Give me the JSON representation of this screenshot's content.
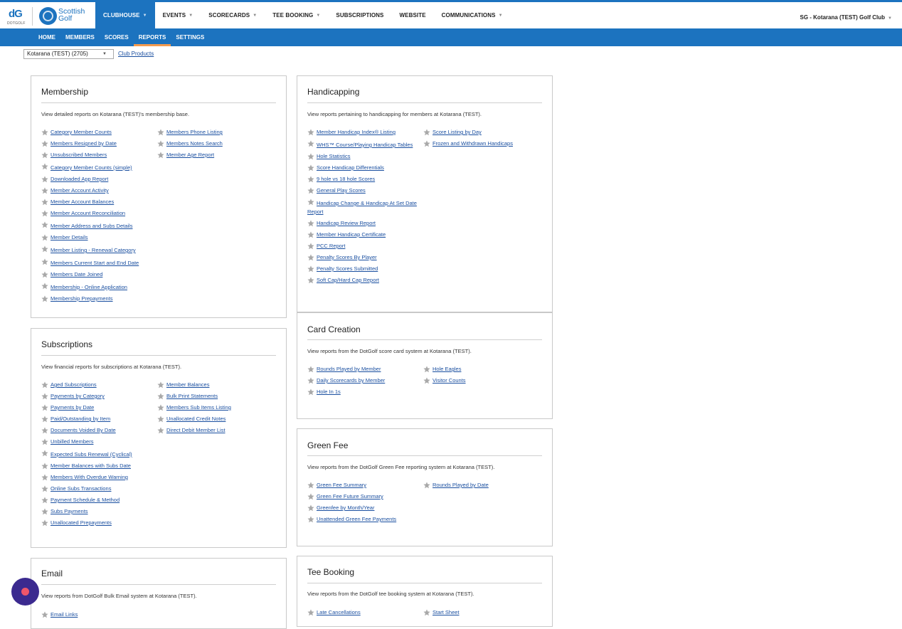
{
  "brand": {
    "dg_mark": "dG",
    "dg_sub": "DOTGOLF",
    "sg_line1": "Scottish",
    "sg_line2": "Golf"
  },
  "mainnav": [
    {
      "label": "CLUBHOUSE",
      "caret": true,
      "active": true
    },
    {
      "label": "EVENTS",
      "caret": true
    },
    {
      "label": "SCORECARDS",
      "caret": true
    },
    {
      "label": "TEE BOOKING",
      "caret": true
    },
    {
      "label": "SUBSCRIPTIONS",
      "caret": false
    },
    {
      "label": "WEBSITE",
      "caret": false
    },
    {
      "label": "COMMUNICATIONS",
      "caret": true
    }
  ],
  "club_name": "SG - Kotarana (TEST) Golf Club",
  "subnav": [
    {
      "label": "HOME"
    },
    {
      "label": "MEMBERS"
    },
    {
      "label": "SCORES"
    },
    {
      "label": "REPORTS",
      "active": true
    },
    {
      "label": "SETTINGS"
    }
  ],
  "club_select": "Kotarana (TEST) (2705)",
  "club_products": "Club Products",
  "panels": {
    "membership": {
      "title": "Membership",
      "desc": "View detailed reports on Kotarana (TEST)'s membership base.",
      "col1": [
        "Category Member Counts",
        "Members Resigned by Date",
        "Unsubscribed Members",
        "Category Member Counts (simple)",
        "Downloaded App Report",
        "Member Account Activity",
        "Member Account Balances",
        "Member Account Reconciliation",
        "Member Address and Subs Details",
        "Member Details",
        "Member Listing - Renewal Category",
        "Members Current Start and End Date",
        "Members Date Joined",
        "Membership - Online Application",
        "Membership Prepayments"
      ],
      "col2": [
        "Members Phone Listing",
        "Members Notes Search",
        "Member Age Report"
      ]
    },
    "handicapping": {
      "title": "Handicapping",
      "desc": "View reports pertaining to handicapping for members at Kotarana (TEST).",
      "col1": [
        "Member Handicap Index® Listing",
        "WHS™ Course/Playing Handicap Tables",
        "Hole Statistics",
        "Score Handicap Differentials",
        "9 hole vs 18 hole Scores",
        "General Play Scores",
        "Handicap Change & Handicap At Set Date Report",
        "Handicap Review Report",
        "Member Handicap Certificate",
        "PCC Report",
        "Penalty Scores By Player",
        "Penalty Scores Submitted",
        "Soft Cap/Hard Cap Report"
      ],
      "col2": [
        "Score Listing by Day",
        "Frozen and Withdrawn Handicaps"
      ]
    },
    "subscriptions": {
      "title": "Subscriptions",
      "desc": "View financial reports for subscriptions at Kotarana (TEST).",
      "col1": [
        "Aged Subscriptions",
        "Payments by Category",
        "Payments by Date",
        "Paid/Outstanding by Item",
        "Documents Voided By Date",
        "Unbilled Members",
        "Expected Subs Renewal (Cyclical)",
        "Member Balances with Subs Date",
        "Members With Overdue Warning",
        "Online Subs Transactions",
        "Payment Schedule & Method",
        "Subs Payments",
        "Unallocated Prepayments"
      ],
      "col2": [
        "Member Balances",
        "Bulk Print Statements",
        "Members Sub Items Listing",
        "Unallocated Credit Notes",
        "Direct Debit Member List"
      ]
    },
    "card_creation": {
      "title": "Card Creation",
      "desc": "View reports from the DotGolf score card system at Kotarana (TEST).",
      "col1": [
        "Rounds Played by Member",
        "Daily Scorecards by Member",
        "Hole In 1s"
      ],
      "col2": [
        "Hole Eagles",
        "Visitor Counts"
      ]
    },
    "green_fee": {
      "title": "Green Fee",
      "desc": "View reports from the DotGolf Green Fee reporting system at Kotarana (TEST).",
      "col1": [
        "Green Fee Summary",
        "Green Fee Future Summary",
        "Greenfee by Month/Year",
        "Unattended Green Fee Payments"
      ],
      "col2": [
        "Rounds Played by Date"
      ]
    },
    "email": {
      "title": "Email",
      "desc": "View reports from DotGolf Bulk Email system at Kotarana (TEST).",
      "col1": [
        "Email Links"
      ],
      "col2": []
    },
    "tee_booking": {
      "title": "Tee Booking",
      "desc": "View reports from the DotGolf tee booking system at Kotarana (TEST).",
      "col1": [
        "Late Cancellations"
      ],
      "col2": [
        "Start Sheet"
      ]
    }
  },
  "colors": {
    "brand_blue": "#1c73bf",
    "link": "#1a4fa0",
    "active_underline": "#f39a4e",
    "chat": "#3b2a8f"
  }
}
